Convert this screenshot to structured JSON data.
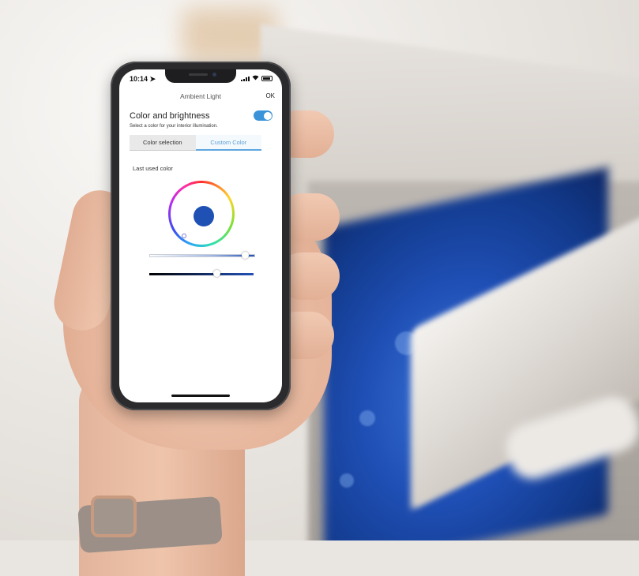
{
  "status_bar": {
    "time": "10:14",
    "location_icon": "location-arrow-icon",
    "signal_icon": "cellular-signal-icon",
    "wifi_icon": "wifi-icon",
    "battery_icon": "battery-icon"
  },
  "nav": {
    "title": "Ambient Light",
    "ok_label": "OK"
  },
  "section": {
    "title": "Color and brightness",
    "subtitle": "Select a color for your interior illumination.",
    "toggle_on": true,
    "accent_color": "#3a93d9"
  },
  "tabs": [
    {
      "label": "Color selection",
      "active": false
    },
    {
      "label": "Custom Color",
      "active": true
    }
  ],
  "last_used_label": "Last used color",
  "selected_color": "#1f50b3",
  "sliders": [
    {
      "name": "saturation",
      "level": 0.9
    },
    {
      "name": "brightness",
      "level": 0.65
    }
  ]
}
